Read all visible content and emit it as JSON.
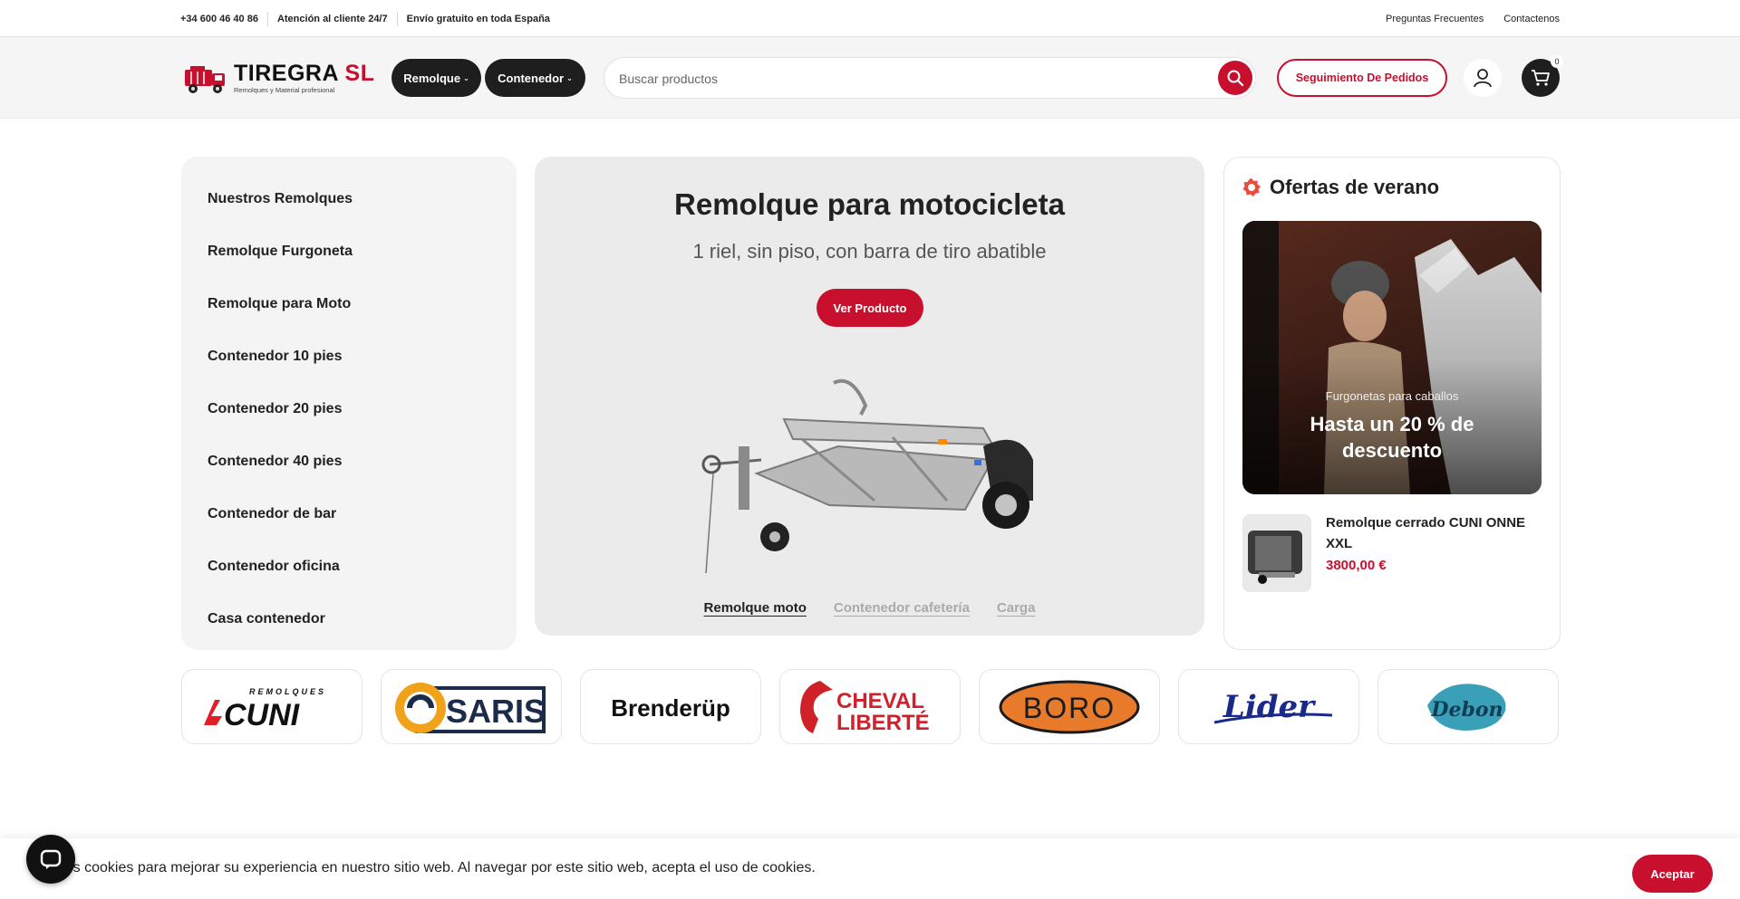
{
  "colors": {
    "accent": "#c8102e",
    "dark": "#1e1e1e",
    "panel": "#f4f4f4"
  },
  "topbar": {
    "phone": "+34 600 46 40 86",
    "support": "Atención al cliente 24/7",
    "shipping": "Envío gratuito en toda España",
    "faq": "Preguntas Frecuentes",
    "contact": "Contactenos"
  },
  "header": {
    "logo_name": "TIREGRA",
    "logo_suffix": "SL",
    "logo_tagline": "Remolques y Material profesional",
    "nav": [
      {
        "label": "Remolque",
        "icon": "chevron-down-icon"
      },
      {
        "label": "Contenedor",
        "icon": "chevron-down-icon"
      }
    ],
    "search_placeholder": "Buscar productos",
    "track_orders": "Seguimiento De Pedidos",
    "cart_count": "0"
  },
  "categories": [
    "Nuestros Remolques",
    "Remolque Furgoneta",
    "Remolque para Moto",
    "Contenedor 10 pies",
    "Contenedor 20 pies",
    "Contenedor 40 pies",
    "Contenedor de bar",
    "Contenedor oficina",
    "Casa contenedor"
  ],
  "hero": {
    "title": "Remolque para motocicleta",
    "subtitle": "1 riel, sin piso, con barra de tiro abatible",
    "cta": "Ver Producto",
    "slides": [
      "Remolque moto",
      "Contenedor cafetería",
      "Carga"
    ],
    "active_slide": 0
  },
  "offers": {
    "title": "Ofertas de verano",
    "promo_sub": "Furgonetas para caballos",
    "promo_main": "Hasta un 20 % de descuento",
    "product_name": "Remolque cerrado CUNI ONNE XXL",
    "product_price": "3800,00 €"
  },
  "brands": [
    "CUNI",
    "SARIS",
    "Brenderup",
    "CHEVAL LIBERTÉ",
    "BORO",
    "Lider",
    "Debon"
  ],
  "brand_logo_text": {
    "cuni_top": "REMOLQUES",
    "cuni": "CUNI",
    "saris": "SARIS",
    "brenderup": "Brenderüp",
    "cheval_1": "CHEVAL",
    "cheval_2": "LIBERTÉ",
    "boro": "BORO",
    "lider": "Lider",
    "debon": "Debon"
  },
  "cookie": {
    "message": "Usamos cookies para mejorar su experiencia en nuestro sitio web. Al navegar por este sitio web, acepta el uso de cookies.",
    "accept": "Aceptar"
  }
}
